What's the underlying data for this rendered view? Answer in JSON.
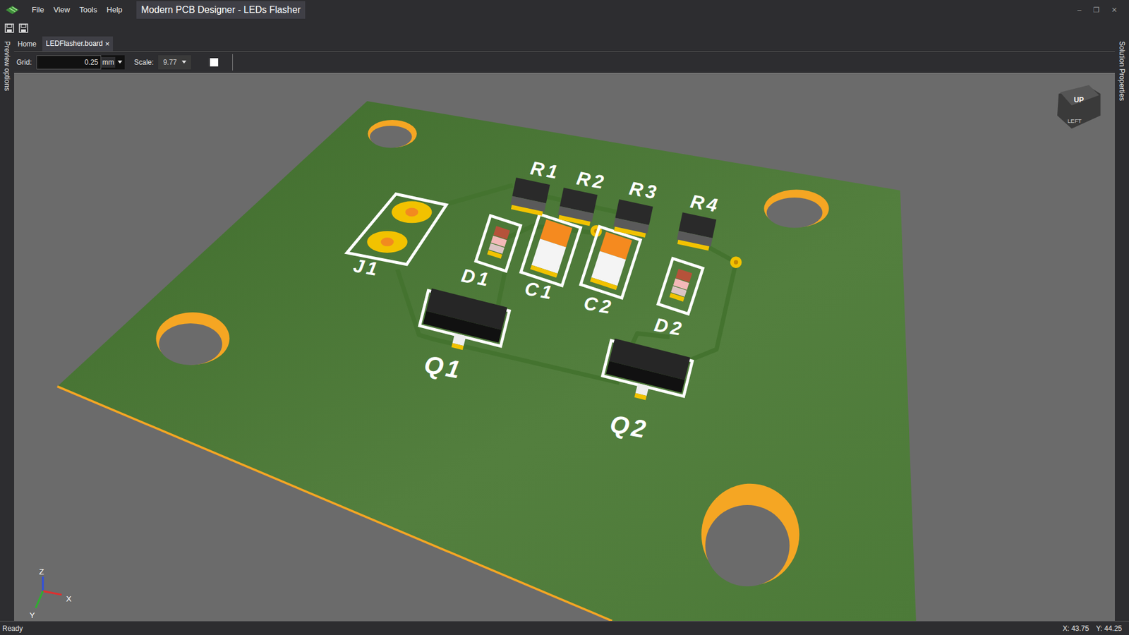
{
  "window": {
    "title": "Modern PCB Designer - LEDs Flasher",
    "controls": [
      "–",
      "❐",
      "✕"
    ]
  },
  "menu": [
    "File",
    "View",
    "Tools",
    "Help"
  ],
  "side_panels": {
    "left": "Preview options",
    "right": "Solution Properties"
  },
  "tabs": [
    {
      "label": "Home",
      "selected": false,
      "close": ""
    },
    {
      "label": "LEDFlasher.board",
      "selected": true,
      "close": "×"
    }
  ],
  "toolbar": {
    "grid_label": "Grid:",
    "grid_value": "0.25",
    "grid_unit": "mm",
    "scale_label": "Scale:",
    "scale_value": "9.77"
  },
  "components": [
    {
      "ref": "J1",
      "kind": "connector"
    },
    {
      "ref": "D1",
      "kind": "diode"
    },
    {
      "ref": "C1",
      "kind": "capacitor"
    },
    {
      "ref": "C2",
      "kind": "capacitor"
    },
    {
      "ref": "D2",
      "kind": "diode"
    },
    {
      "ref": "Q1",
      "kind": "transistor"
    },
    {
      "ref": "Q2",
      "kind": "transistor"
    },
    {
      "ref": "R1",
      "kind": "resistor"
    },
    {
      "ref": "R2",
      "kind": "resistor"
    },
    {
      "ref": "R3",
      "kind": "resistor"
    },
    {
      "ref": "R4",
      "kind": "resistor"
    }
  ],
  "view_cube": {
    "top": "UP",
    "front": "LEFT"
  },
  "axes": {
    "x": "X",
    "y": "Y",
    "z": "Z"
  },
  "status_bar": {
    "status": "Ready",
    "x": "X: 43.75",
    "y": "Y: 44.25"
  }
}
